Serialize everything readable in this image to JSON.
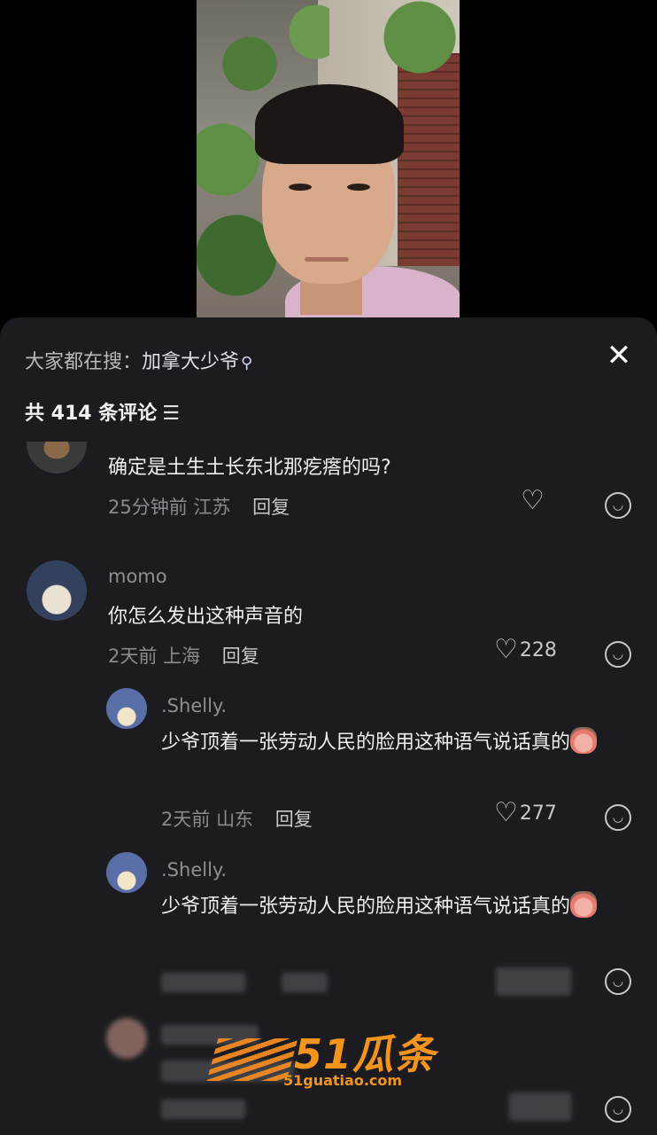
{
  "search": {
    "prefix": "大家都在搜：",
    "keyword": "加拿大少爷",
    "icon": "search-icon"
  },
  "close_icon": "close-icon",
  "comment_count": "共 414 条评论",
  "filter_icon": "filter-icon",
  "comments": [
    {
      "name": "",
      "text": "确定是土生土长东北那疙瘩的吗?",
      "time": "25分钟前",
      "location": "江苏",
      "reply": "回复",
      "likes": ""
    },
    {
      "name": "momo",
      "text": "你怎么发出这种声音的",
      "time": "2天前",
      "location": "上海",
      "reply": "回复",
      "likes": "228"
    },
    {
      "name": ".Shelly.",
      "text": "少爷顶着一张劳动人民的脸用这种语气说话真的",
      "time": "2天前",
      "location": "山东",
      "reply": "回复",
      "likes": "277"
    },
    {
      "name": ".Shelly.",
      "text": "少爷顶着一张劳动人民的脸用这种语气说话真的",
      "time": "",
      "location": "",
      "reply": "",
      "likes": ""
    }
  ],
  "watermark": {
    "main": "51瓜条",
    "url": "51guatiao.com"
  },
  "colors": {
    "sheet_bg": "#1c1c20",
    "watermark": "#f3941f"
  }
}
